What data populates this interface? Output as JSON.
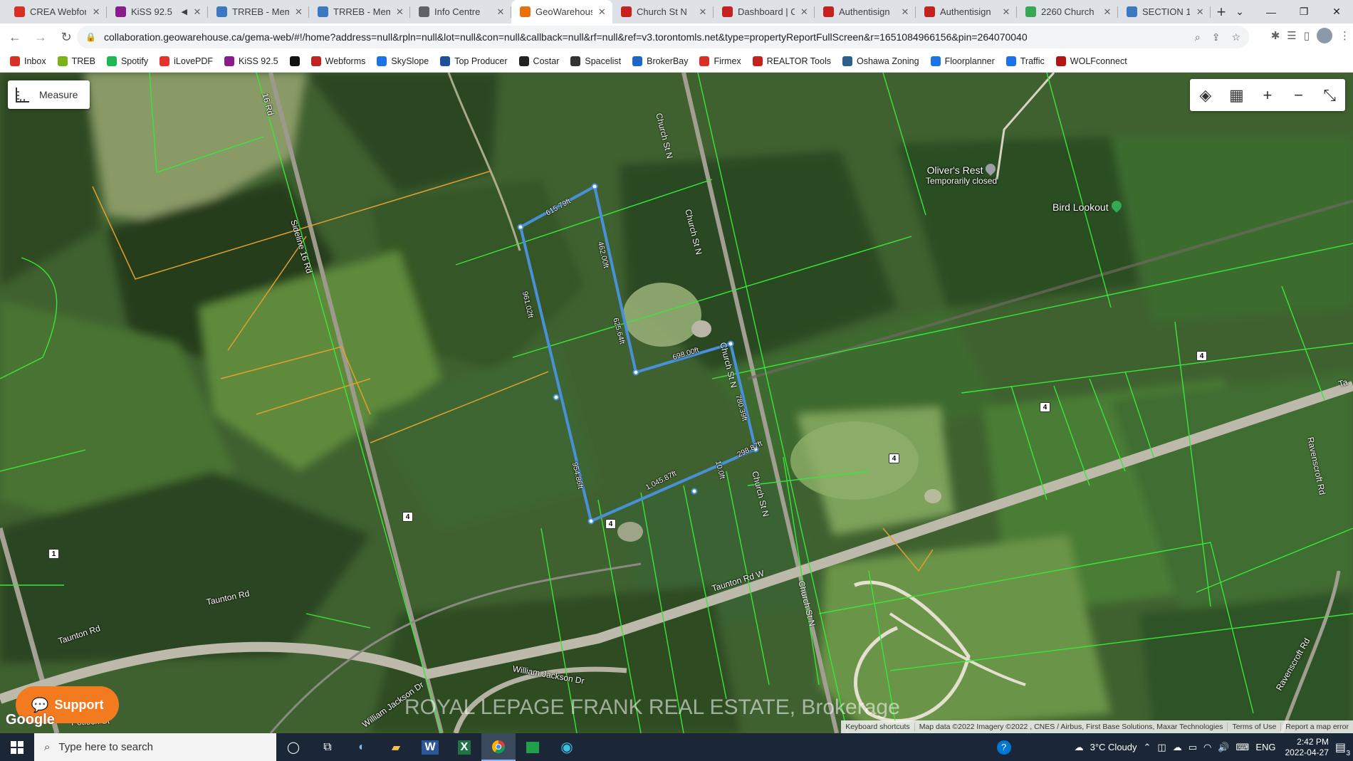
{
  "browser": {
    "tabs": [
      {
        "title": "CREA Webfor",
        "icon": "gmail-icon",
        "color": "#d93025",
        "active": false
      },
      {
        "title": "KiSS 92.5",
        "icon": "kiss-icon",
        "color": "#8b1a8b",
        "active": false,
        "audio": "◀"
      },
      {
        "title": "TRREB - Mem",
        "icon": "trreb-icon",
        "color": "#3a78c2",
        "active": false
      },
      {
        "title": "TRREB - Mem",
        "icon": "trreb-icon",
        "color": "#3a78c2",
        "active": false
      },
      {
        "title": "Info Centre",
        "icon": "globe-icon",
        "color": "#5f6368",
        "active": false
      },
      {
        "title": "GeoWarehous",
        "icon": "geowarehouse-icon",
        "color": "#e8710a",
        "active": true
      },
      {
        "title": "Church St N",
        "icon": "webforms-icon",
        "color": "#c5221f",
        "active": false
      },
      {
        "title": "Dashboard | C",
        "icon": "webforms-icon",
        "color": "#c5221f",
        "active": false
      },
      {
        "title": "Authentisign",
        "icon": "webforms-icon",
        "color": "#c5221f",
        "active": false
      },
      {
        "title": "Authentisign",
        "icon": "webforms-icon",
        "color": "#c5221f",
        "active": false
      },
      {
        "title": "2260 Church",
        "icon": "maps-pin-icon",
        "color": "#34a853",
        "active": false
      },
      {
        "title": "SECTION 1",
        "icon": "trreb-icon",
        "color": "#3a78c2",
        "active": false
      }
    ],
    "new_tab": "+",
    "url": "collaboration.geowarehouse.ca/gema-web/#!/home?address=null&rpln=null&lot=null&con=null&callback=null&rf=null&ref=v3.torontomls.net&type=propertyReportFullScreen&r=1651084966156&pin=264070040",
    "bookmarks": [
      {
        "label": "Inbox",
        "icon": "gmail-icon",
        "color": "#d93025"
      },
      {
        "label": "TREB",
        "icon": "treb-leaf-icon",
        "color": "#7ab317"
      },
      {
        "label": "Spotify",
        "icon": "spotify-icon",
        "color": "#1db954"
      },
      {
        "label": "iLovePDF",
        "icon": "ilovepdf-icon",
        "color": "#e5322d"
      },
      {
        "label": "KiSS 92.5",
        "icon": "kiss-icon",
        "color": "#8b1a8b"
      },
      {
        "label": "",
        "icon": "circle-logo-icon",
        "color": "#111111"
      },
      {
        "label": "Webforms",
        "icon": "webforms-icon",
        "color": "#c5221f"
      },
      {
        "label": "SkySlope",
        "icon": "skyslope-icon",
        "color": "#1a73e8"
      },
      {
        "label": "Top Producer",
        "icon": "top-producer-icon",
        "color": "#1f4e9b"
      },
      {
        "label": "Costar",
        "icon": "costar-icon",
        "color": "#222222"
      },
      {
        "label": "Spacelist",
        "icon": "spacelist-icon",
        "color": "#333333"
      },
      {
        "label": "BrokerBay",
        "icon": "brokerbay-icon",
        "color": "#1b66c9"
      },
      {
        "label": "Firmex",
        "icon": "firmex-icon",
        "color": "#d93025"
      },
      {
        "label": "REALTOR Tools",
        "icon": "webforms-icon",
        "color": "#c5221f"
      },
      {
        "label": "Oshawa Zoning",
        "icon": "oshawa-icon",
        "color": "#2c5f8a"
      },
      {
        "label": "Floorplanner",
        "icon": "floorplanner-icon",
        "color": "#1a73e8"
      },
      {
        "label": "Traffic",
        "icon": "traffic-icon",
        "color": "#1a73e8"
      },
      {
        "label": "WOLFconnect",
        "icon": "wolf-icon",
        "color": "#b31412"
      }
    ]
  },
  "map": {
    "measure_button": "Measure",
    "controls": [
      {
        "name": "layers",
        "glyph": "◈"
      },
      {
        "name": "map-type",
        "glyph": "▦"
      },
      {
        "name": "zoom-in",
        "glyph": "+"
      },
      {
        "name": "zoom-out",
        "glyph": "−"
      },
      {
        "name": "exit-fullscreen",
        "glyph": "⤡"
      }
    ],
    "road_labels": {
      "sideline16": "Sideline 16 Rd",
      "sideline16b": "16 Rd",
      "church1": "Church St N",
      "church2": "Church St N",
      "church3": "Church St N",
      "church4": "Church St N",
      "church5": "Church St N",
      "taunton1": "Taunton Rd",
      "taunton2": "Taunton Rd",
      "taunton3": "Taunton Rd W",
      "taunton4": "Ta",
      "jackson1": "William Jackson Dr",
      "jackson2": "William Jackson Dr",
      "ravenscroft1": "Ravenscroft Rd",
      "ravenscroft2": "Ravenscroft Rd",
      "pebble": "Potlock St"
    },
    "route_shields": [
      "4",
      "4",
      "4",
      "4",
      "4",
      "1"
    ],
    "measurements": [
      "615.79ft",
      "462.00ft",
      "961.02ft",
      "625.64ft",
      "698.00ft",
      "780.39ft",
      "298.87ft",
      "10.0ft",
      "1,045.87ft",
      "954.86ft"
    ],
    "poi": [
      {
        "name": "Oliver's Rest",
        "sub": "Temporarily closed",
        "pin_color": "#9aa0a6"
      },
      {
        "name": "Bird Lookout",
        "sub": "",
        "pin_color": "#34a853"
      }
    ],
    "support_button": "Support",
    "watermark": "ROYAL LEPAGE FRANK REAL ESTATE, Brokerage",
    "google_logo": "Google",
    "attribution": [
      "Keyboard shortcuts",
      "Map data ©2022 Imagery ©2022 , CNES / Airbus, First Base Solutions, Maxar Technologies",
      "Terms of Use",
      "Report a map error"
    ],
    "colors": {
      "parcel_lines": "#39e639",
      "measure_line": "#4a90d9",
      "orange_lines": "#e0a030"
    }
  },
  "taskbar": {
    "search_placeholder": "Type here to search",
    "weather": "3°C  Cloudy",
    "language": "ENG",
    "time": "2:42 PM",
    "date": "2022-04-27",
    "notification_count": "3"
  }
}
